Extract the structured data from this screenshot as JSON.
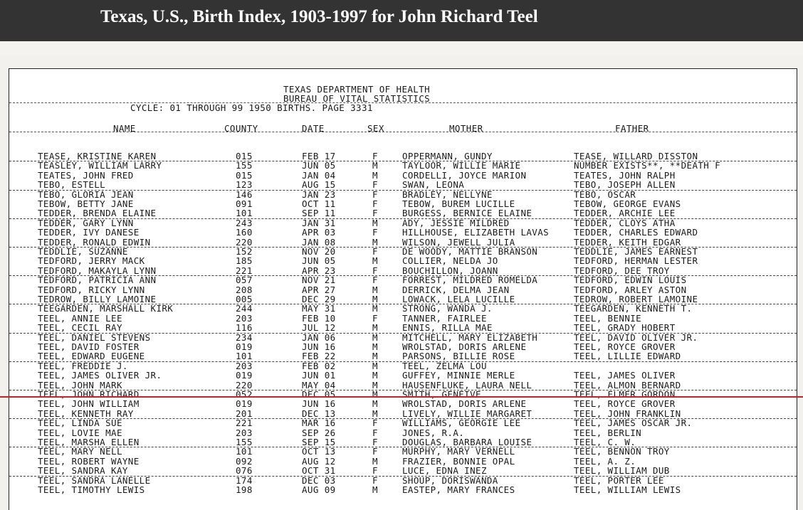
{
  "page": {
    "title": "Texas, U.S., Birth Index, 1903-1997 for John Richard Teel"
  },
  "document": {
    "header1": "TEXAS DEPARTMENT OF HEALTH",
    "header2": "BUREAU OF VITAL STATISTICS",
    "cycle": "CYCLE:  01 THROUGH 99  1950 BIRTHS.  PAGE 3331",
    "columns": {
      "name": "NAME",
      "county": "COUNTY",
      "date": "DATE",
      "sex": "SEX",
      "mother": "MOTHER",
      "father": "FATHER"
    },
    "highlighted_record": "TEEL, JOHN RICHARD",
    "rows": [
      {
        "name": "TEASE, KRISTINE KAREN",
        "county": "015",
        "date": "FEB 17",
        "sex": "F",
        "mother": "OPPERMANN, GUNDY",
        "father": "TEASE, WILLARD DISSTON",
        "ul": true
      },
      {
        "name": "TEASLEY, WILLIAM LARRY",
        "county": "155",
        "date": "JUN 05",
        "sex": "M",
        "mother": "TAYLOOR, WILLIE MARIE",
        "father": "NUMBER EXISTS**, **DEATH F",
        "ul": false
      },
      {
        "name": "TEATES, JOHN FRED",
        "county": "015",
        "date": "JAN 04",
        "sex": "M",
        "mother": "CORDELLI, JOYCE MARION",
        "father": "TEATES, JOHN RALPH",
        "ul": false
      },
      {
        "name": "TEBO, ESTELL",
        "county": "123",
        "date": "AUG 15",
        "sex": "F",
        "mother": "SWAN, LEONA",
        "father": "TEBO, JOSEPH ALLEN",
        "ul": true
      },
      {
        "name": "TEBO, GLORIA JEAN",
        "county": "146",
        "date": "JAN 23",
        "sex": "F",
        "mother": "BRADLEY, NELLYNE",
        "father": "TEBO, OSCAR",
        "ul": false
      },
      {
        "name": "TEBOW, BETTY JANE",
        "county": "091",
        "date": "OCT 11",
        "sex": "F",
        "mother": "TEBOW, BUREM LUCILLE",
        "father": "TEBOW, GEORGE EVANS",
        "ul": false
      },
      {
        "name": "TEDDER, BRENDA ELAINE",
        "county": "101",
        "date": "SEP 11",
        "sex": "F",
        "mother": "BURGESS, BERNICE ELAINE",
        "father": "TEDDER, ARCHIE LEE",
        "ul": true
      },
      {
        "name": "TEDDER, GARY LYNN",
        "county": "243",
        "date": "JAN 31",
        "sex": "M",
        "mother": "ADY, JESSIE MILDRED",
        "father": "TEDDER, CLOYS ATHA",
        "ul": false
      },
      {
        "name": "TEDDER, IVY DANESE",
        "county": "160",
        "date": "APR 03",
        "sex": "F",
        "mother": "HILLHOUSE, ELIZABETH LAVAS",
        "father": "TEDDER, CHARLES EDWARD",
        "ul": false
      },
      {
        "name": "TEDDER, RONALD EDWIN",
        "county": "220",
        "date": "JAN 08",
        "sex": "M",
        "mother": "WILSON, JEWELL JULIA",
        "father": "TEDDER, KEITH EDGAR",
        "ul": true
      },
      {
        "name": "TEDDLIE, SUZANNE",
        "county": "152",
        "date": "NOV 20",
        "sex": "F",
        "mother": "DE WOODY, MATTIE BRANSON",
        "father": "TEDDLIE, JAMES EARNEST",
        "ul": false
      },
      {
        "name": "TEDFORD, JERRY MACK",
        "county": "185",
        "date": "JUN 05",
        "sex": "M",
        "mother": "COLLIER, NELDA JO",
        "father": "TEDFORD, HERMAN LESTER",
        "ul": false
      },
      {
        "name": "TEDFORD, MAKAYLA LYNN",
        "county": "221",
        "date": "APR 23",
        "sex": "F",
        "mother": "BOUCHILLON, JOANN",
        "father": "TEDFORD, DEE TROY",
        "ul": true
      },
      {
        "name": "TEDFORD, PATRICIA ANN",
        "county": "057",
        "date": "NOV 21",
        "sex": "F",
        "mother": "FORREST, MILDRED ROMELDA",
        "father": "TEDFORD, EDWIN LOUIS",
        "ul": false
      },
      {
        "name": "TEDFORD, RICKY LYNN",
        "county": "208",
        "date": "APR 27",
        "sex": "M",
        "mother": "DERRICK, DELMA JEAN",
        "father": "TEDFORD, ARLEY ASTON",
        "ul": false
      },
      {
        "name": "TEDROW, BILLY LAMOINE",
        "county": "005",
        "date": "DEC 29",
        "sex": "M",
        "mother": "LOWACK, LELA LUCILLE",
        "father": "TEDROW, ROBERT LAMOINE",
        "ul": true
      },
      {
        "name": "TEEGARDEN, MARSHALL KIRK",
        "county": "244",
        "date": "MAY 31",
        "sex": "M",
        "mother": "STRONG, WANDA J.",
        "father": "TEEGARDEN, KENNETH T.",
        "ul": false
      },
      {
        "name": "TEEL, ANNIE LEE",
        "county": "203",
        "date": "FEB 10",
        "sex": "F",
        "mother": "TANNER, FAIRLEE",
        "father": "TEEL, BENNIE",
        "ul": false
      },
      {
        "name": "TEEL, CECIL RAY",
        "county": "116",
        "date": "JUL 12",
        "sex": "M",
        "mother": "ENNIS, RILLA MAE",
        "father": "TEEL, GRADY HOBERT",
        "ul": true
      },
      {
        "name": "TEEL, DANIEL STEVENS",
        "county": "234",
        "date": "JAN 06",
        "sex": "M",
        "mother": "MITCHELL, MARY ELIZABETH",
        "father": "TEEL, DAVID OLIVER JR.",
        "ul": false
      },
      {
        "name": "TEEL, DAVID FOSTER",
        "county": "019",
        "date": "JUN 16",
        "sex": "M",
        "mother": "WROLSTAD, DORIS ARLENE",
        "father": "TEEL, ROYCE GROVER",
        "ul": false
      },
      {
        "name": "TEEL, EDWARD EUGENE",
        "county": "101",
        "date": "FEB 22",
        "sex": "M",
        "mother": "PARSONS, BILLIE ROSE",
        "father": "TEEL, LILLIE EDWARD",
        "ul": true
      },
      {
        "name": "TEEL, FREDDIE J.",
        "county": "203",
        "date": "FEB 02",
        "sex": "M",
        "mother": "TEEL, ZELMA LOU",
        "father": "",
        "ul": false
      },
      {
        "name": "TEEL, JAMES OLIVER JR.",
        "county": "019",
        "date": "JUN 01",
        "sex": "M",
        "mother": "GUFFEY, MINNIE MERLE",
        "father": "TEEL, JAMES OLIVER",
        "ul": false
      },
      {
        "name": "TEEL, JOHN MARK",
        "county": "220",
        "date": "MAY 04",
        "sex": "M",
        "mother": "HAUSENFLUKE, LAURA NELL",
        "father": "TEEL, ALMON BERNARD",
        "ul": true
      },
      {
        "name": "TEEL, JOHN RICHARD",
        "county": "052",
        "date": "DEC 05",
        "sex": "M",
        "mother": "SMITH, GENEIVE",
        "father": "TEEL, ELMER GORDON",
        "ul": false
      },
      {
        "name": "TEEL, JOHN WILLIAM",
        "county": "019",
        "date": "JUN 16",
        "sex": "M",
        "mother": "WROLSTAD, DORIS ARLENE",
        "father": "TEEL, ROYCE GROVER",
        "ul": false
      },
      {
        "name": "TEEL, KENNETH RAY",
        "county": "201",
        "date": "DEC 13",
        "sex": "M",
        "mother": "LIVELY, WILLIE MARGARET",
        "father": "TEEL, JOHN FRANKLIN",
        "ul": true
      },
      {
        "name": "TEEL, LINDA SUE",
        "county": "221",
        "date": "MAR 16",
        "sex": "F",
        "mother": "WILLIAMS, GEORGIE LEE",
        "father": "TEEL, JAMES OSCAR JR.",
        "ul": false
      },
      {
        "name": "TEEL, LOVIE MAE",
        "county": "203",
        "date": "SEP 26",
        "sex": "F",
        "mother": "JONES, R.A.",
        "father": "TEEL, BERLIN",
        "ul": false
      },
      {
        "name": "TEEL, MARSHA ELLEN",
        "county": "155",
        "date": "SEP 15",
        "sex": "F",
        "mother": "DOUGLAS, BARBARA LOUISE",
        "father": "TEEL, C. W.",
        "ul": true
      },
      {
        "name": "TEEL, MARY NELL",
        "county": "101",
        "date": "OCT 13",
        "sex": "F",
        "mother": "MURPHY, MARY VERNELL",
        "father": "TEEL, BENNON TROY",
        "ul": false
      },
      {
        "name": "TEEL, ROBERT WAYNE",
        "county": "092",
        "date": "AUG 12",
        "sex": "M",
        "mother": "FRAZIER, BONNIE OPAL",
        "father": "TEEL, A. Z.",
        "ul": false
      },
      {
        "name": "TEEL, SANDRA KAY",
        "county": "076",
        "date": "OCT 31",
        "sex": "F",
        "mother": "LUCE, EDNA INEZ",
        "father": "TEEL, WILLIAM DUB",
        "ul": true
      },
      {
        "name": "TEEL, SANDRA LANELLE",
        "county": "174",
        "date": "DEC 03",
        "sex": "F",
        "mother": "SHOUP, DORISWANDA",
        "father": "TEEL, PORTER LEE",
        "ul": false
      },
      {
        "name": "TEEL, TIMOTHY LEWIS",
        "county": "198",
        "date": "AUG 09",
        "sex": "M",
        "mother": "EASTEP, MARY FRANCES",
        "father": "TEEL, WILLIAM LEWIS",
        "ul": false
      }
    ]
  },
  "colors": {
    "topbar": "#333333",
    "highlight": "#c9202a",
    "paper": "#ffffff"
  }
}
